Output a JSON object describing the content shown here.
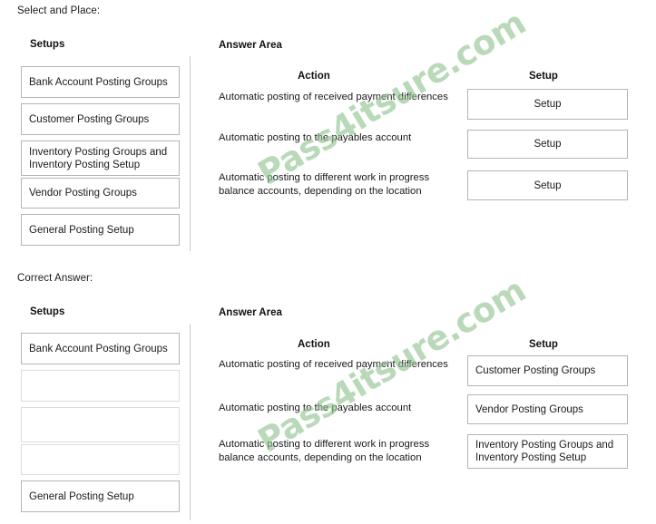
{
  "sections": {
    "top": {
      "label": "Select and Place:",
      "setups_heading": "Setups",
      "answer_heading": "Answer Area",
      "action_heading": "Action",
      "setup_heading": "Setup",
      "setups": [
        {
          "label": "Bank Account Posting Groups",
          "empty": false
        },
        {
          "label": "Customer Posting Groups",
          "empty": false
        },
        {
          "label": "Inventory Posting Groups and\nInventory Posting Setup",
          "empty": false
        },
        {
          "label": "Vendor Posting Groups",
          "empty": false
        },
        {
          "label": "General Posting Setup",
          "empty": false
        }
      ],
      "actions": [
        "Automatic posting of received payment differences",
        "Automatic posting to the payables account",
        "Automatic posting to different work in progress balance accounts, depending on the location"
      ],
      "slots": [
        {
          "label": "Setup",
          "filled": false
        },
        {
          "label": "Setup",
          "filled": false
        },
        {
          "label": "Setup",
          "filled": false
        }
      ]
    },
    "bottom": {
      "label": "Correct Answer:",
      "setups_heading": "Setups",
      "answer_heading": "Answer Area",
      "action_heading": "Action",
      "setup_heading": "Setup",
      "setups": [
        {
          "label": "Bank Account Posting Groups",
          "empty": false
        },
        {
          "label": "",
          "empty": true
        },
        {
          "label": "",
          "empty": true
        },
        {
          "label": "",
          "empty": true
        },
        {
          "label": "General Posting Setup",
          "empty": false
        }
      ],
      "actions": [
        "Automatic posting of received payment differences",
        "Automatic posting to the payables account",
        "Automatic posting to different work in progress balance accounts, depending on the location"
      ],
      "slots": [
        {
          "label": "Customer Posting Groups",
          "filled": true
        },
        {
          "label": "Vendor Posting Groups",
          "filled": true
        },
        {
          "label": "Inventory Posting Groups and\nInventory Posting Setup",
          "filled": true
        }
      ]
    }
  },
  "watermark": {
    "text": "Pass4itsure.com",
    "color": "#8fc28f"
  }
}
